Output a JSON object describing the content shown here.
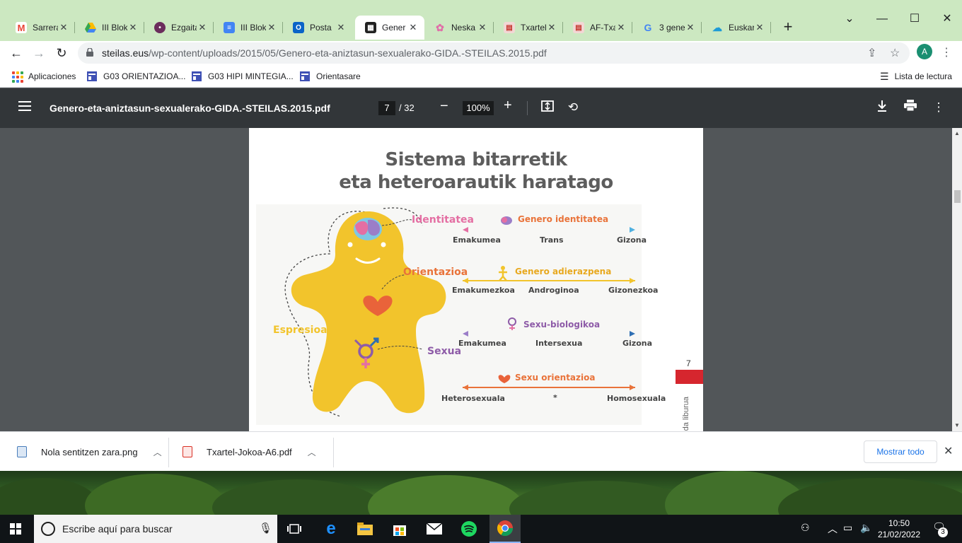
{
  "tabs": [
    {
      "title": "Sarrera",
      "icon": "gmail-icon",
      "color": "#ea4335"
    },
    {
      "title": "III Blok",
      "icon": "drive-icon",
      "color": "#34a853"
    },
    {
      "title": "Ezgaita",
      "icon": "site-icon",
      "color": "#6b2d5c"
    },
    {
      "title": "III Blok",
      "icon": "docs-icon",
      "color": "#4285f4"
    },
    {
      "title": "Posta",
      "icon": "outlook-icon",
      "color": "#0a64c8"
    },
    {
      "title": "Gener",
      "icon": "pdf-site-icon",
      "color": "#222222"
    },
    {
      "title": "Neska",
      "icon": "flower-icon",
      "color": "#e06fa8"
    },
    {
      "title": "Txartel",
      "icon": "card-icon",
      "color": "#c4342b"
    },
    {
      "title": "AF-Txa",
      "icon": "card-icon",
      "color": "#c4342b"
    },
    {
      "title": "3 gene",
      "icon": "google-icon",
      "color": "#4285f4"
    },
    {
      "title": "Euskar",
      "icon": "cloud-icon",
      "color": "#1e9bd7"
    }
  ],
  "active_tab": 5,
  "url": {
    "host": "steilas.eus",
    "path": "/wp-content/uploads/2015/05/Genero-eta-aniztasun-sexualerako-GIDA.-STEILAS.2015.pdf"
  },
  "profile_initial": "A",
  "bookmarks": {
    "apps": "Aplicaciones",
    "items": [
      "G03 ORIENTAZIOA...",
      "G03 HIPI MINTEGIA...",
      "Orientasare"
    ],
    "reading_list": "Lista de lectura"
  },
  "pdf": {
    "filename": "Genero-eta-aniztasun-sexualerako-GIDA.-STEILAS.2015.pdf",
    "page": "7",
    "total": "/ 32",
    "zoom": "100%",
    "content": {
      "title_line1": "Sistema bitarretik",
      "title_line2": "eta heteroarautik haratago",
      "identitatea": "Identitatea",
      "orientazioa": "Orientazioa",
      "espresioa": "Espresioa",
      "sexua": "Sexua",
      "genero_identitatea": "Genero identitatea",
      "gi_labels": [
        "Emakumea",
        "Trans",
        "Gizona"
      ],
      "genero_adierazpena": "Genero adierazpena",
      "ga_labels": [
        "Emakumezkoa",
        "Androginoa",
        "Gizonezkoa"
      ],
      "sexu_biologikoa": "Sexu-biologikoa",
      "sb_labels": [
        "Emakumea",
        "Intersexua",
        "Gizona"
      ],
      "sexu_orientazioa": "Sexu orientazioa",
      "so_labels": [
        "Heterosexuala",
        "*",
        "Homosexuala"
      ],
      "page_number": "7",
      "side_text": "gida liburua"
    }
  },
  "downloads": {
    "items": [
      "Nola sentitzen zara.png",
      "Txartel-Jokoa-A6.pdf"
    ],
    "show_all": "Mostrar todo"
  },
  "taskbar": {
    "search_placeholder": "Escribe aquí para buscar",
    "time": "10:50",
    "date": "21/02/2022",
    "notifications": "3"
  }
}
